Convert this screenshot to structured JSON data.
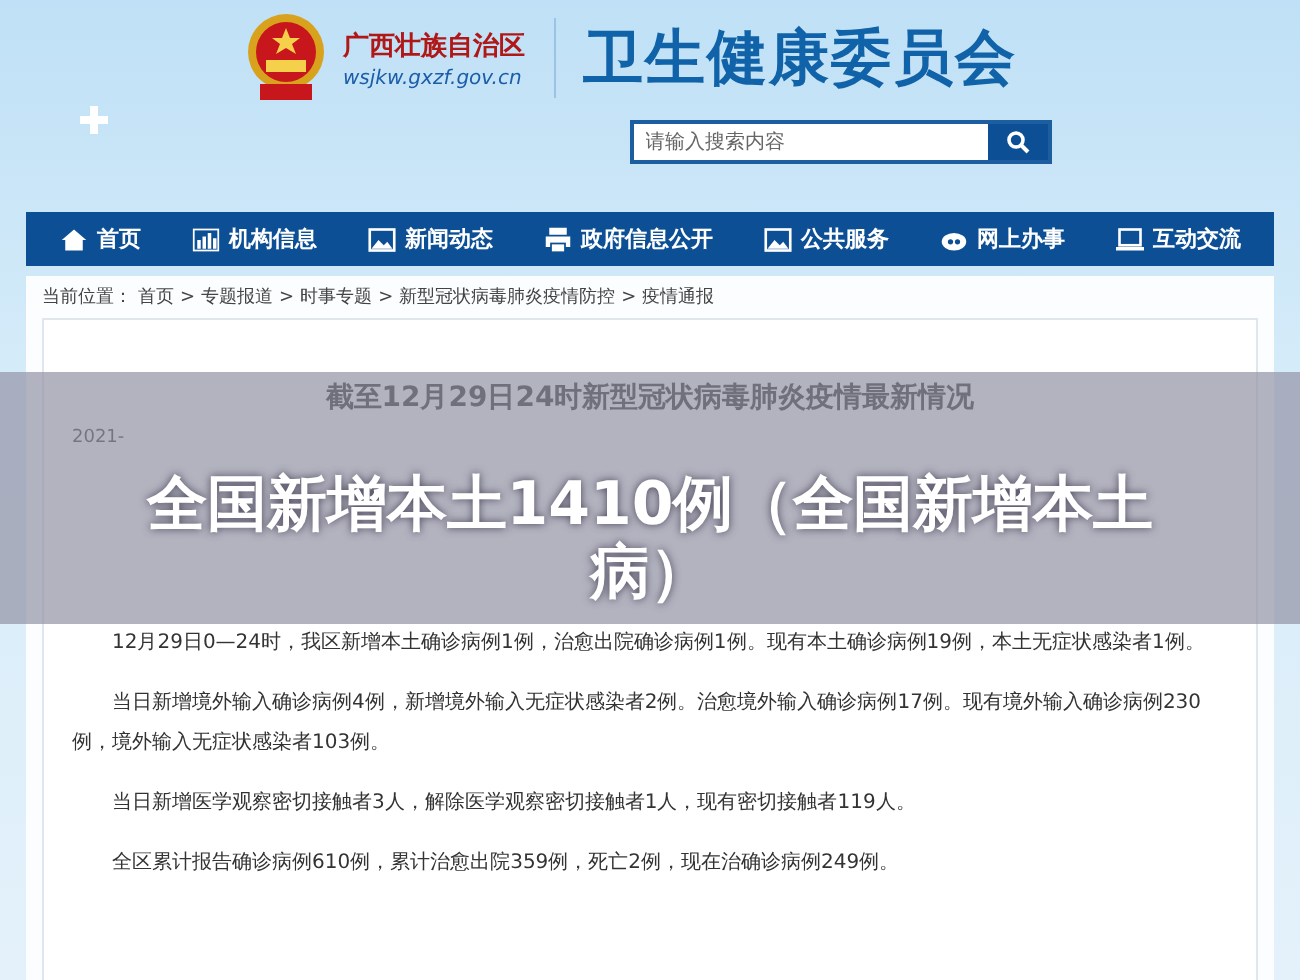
{
  "header": {
    "region": "广西壮族自治区",
    "domain": "wsjkw.gxzf.gov.cn",
    "title": "卫生健康委员会",
    "search": {
      "placeholder": "请输入搜索内容"
    }
  },
  "nav": [
    {
      "label": "首页"
    },
    {
      "label": "机构信息"
    },
    {
      "label": "新闻动态"
    },
    {
      "label": "政府信息公开"
    },
    {
      "label": "公共服务"
    },
    {
      "label": "网上办事"
    },
    {
      "label": "互动交流"
    }
  ],
  "breadcrumb": {
    "prefix": "当前位置：",
    "separator": ">",
    "items": [
      "首页",
      "专题报道",
      "时事专题",
      "新型冠状病毒肺炎疫情防控",
      "疫情通报"
    ]
  },
  "article": {
    "title": "截至12月29日24时新型冠状病毒肺炎疫情最新情况",
    "date": "2021-",
    "paragraphs": [
      "12月29日0—24时，我区新增本土确诊病例1例，治愈出院确诊病例1例。现有本土确诊病例19例，本土无症状感染者1例。",
      "当日新增境外输入确诊病例4例，新增境外输入无症状感染者2例。治愈境外输入确诊病例17例。现有境外输入确诊病例230例，境外输入无症状感染者103例。",
      "当日新增医学观察密切接触者3人，解除医学观察密切接触者1人，现有密切接触者119人。",
      "全区累计报告确诊病例610例，累计治愈出院359例，死亡2例，现在治确诊病例249例。"
    ]
  },
  "overlay": {
    "caption": "全国新增本土1410例（全国新增本土病）"
  }
}
